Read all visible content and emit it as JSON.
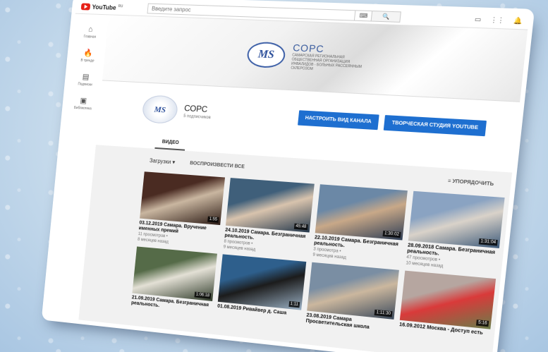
{
  "topbar": {
    "logo_text": "YouTube",
    "logo_sup": "RU",
    "search_placeholder": "Введите запрос",
    "keyboard_icon": "⌨",
    "search_icon": "🔍",
    "icons": [
      "video-camera-icon",
      "apps-grid-icon",
      "bell-icon"
    ],
    "video_icon": "▭",
    "apps_icon": "⋮⋮",
    "bell_icon": "🔔"
  },
  "sidebar": {
    "items": [
      {
        "icon": "⌂",
        "label": "Главная"
      },
      {
        "icon": "🔥",
        "label": "В тренде"
      },
      {
        "icon": "▤",
        "label": "Подписки"
      },
      {
        "icon": "▣",
        "label": "Библиотека"
      }
    ]
  },
  "banner": {
    "logo_text": "MS",
    "title": "СОРС",
    "subtitle": "САМАРСКАЯ РЕГИОНАЛЬНАЯ ОБЩЕСТВЕННАЯ ОРГАНИЗАЦИЯ ИНВАЛИДОВ - БОЛЬНЫХ РАССЕЯННЫМ СКЛЕРОЗОМ"
  },
  "channel": {
    "avatar_text": "MS",
    "name": "СОРС",
    "subscribers": "5 подписчиков",
    "customize_button": "НАСТРОИТЬ ВИД КАНАЛА",
    "studio_button": "ТВОРЧЕСКАЯ СТУДИЯ YOUTUBE"
  },
  "tabs": {
    "video": "ВИДЕО"
  },
  "uploads": {
    "dropdown": "Загрузки ▾",
    "play_all": "ВОСПРОИЗВЕСТИ ВСЕ",
    "sort": "≡ УПОРЯДОЧИТЬ"
  },
  "videos": [
    {
      "title": "03.12.2019 Самара. Вручение именных премий",
      "views": "11 просмотров •",
      "age": "8 месяцев назад",
      "duration": "1:55",
      "colors": [
        "#4a2b22",
        "#c9b6a0",
        "#2b1a14"
      ]
    },
    {
      "title": "24.10.2019 Самара. Безграничная реальность.",
      "views": "8 просмотров •",
      "age": "9 месяцев назад",
      "duration": "45:48",
      "colors": [
        "#3f5f7a",
        "#d8c3ad",
        "#22364a"
      ]
    },
    {
      "title": "22.10.2019 Самара. Безграничная реальность.",
      "views": "3 просмотра •",
      "age": "9 месяцев назад",
      "duration": "1:30:02",
      "colors": [
        "#6b88a6",
        "#c8a888",
        "#2d3d55"
      ]
    },
    {
      "title": "28.09.2018 Самара. Безграничная реальность.",
      "views": "47 просмотров •",
      "age": "10 месяцев назад",
      "duration": "1:31:04",
      "colors": [
        "#8aa3c2",
        "#d9d2c9",
        "#3d5a7a"
      ]
    },
    {
      "title": "21.09.2019 Самара. Безграничная реальность.",
      "views": "",
      "age": "",
      "duration": "1:06:18",
      "colors": [
        "#556b48",
        "#e3e0d5",
        "#2f3b2a"
      ]
    },
    {
      "title": "01.08.2019 Ривайвер д. Саша",
      "views": "",
      "age": "",
      "duration": "1:11",
      "colors": [
        "#2e5f8c",
        "#1c1c1c",
        "#9ab0c4"
      ]
    },
    {
      "title": "23.08.2019 Самара Просветительская школа",
      "views": "",
      "age": "",
      "duration": "1:11:30",
      "colors": [
        "#7a8ea3",
        "#cbb79e",
        "#3b4a5c"
      ]
    },
    {
      "title": "16.09.2012 Москва - Доступ есть",
      "views": "",
      "age": "",
      "duration": "5:16",
      "colors": [
        "#b6a6a0",
        "#d93a3a",
        "#6a7d4a"
      ]
    }
  ]
}
